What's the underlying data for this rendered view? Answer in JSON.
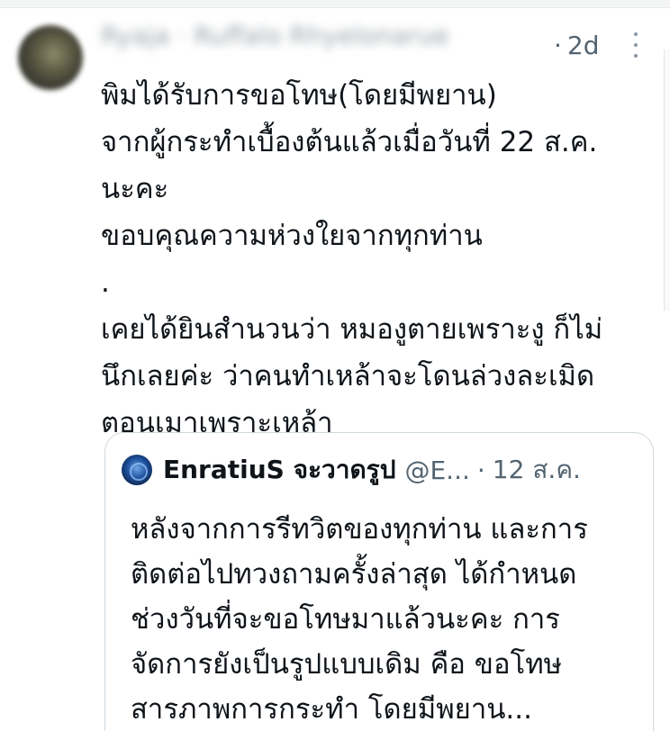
{
  "tweet": {
    "display_name": "Ryaja · Ruffalo Rhyelonarue",
    "separator": "·",
    "time": "2d",
    "more_icon": "more-vertical-icon",
    "lines": [
      "พิมได้รับการขอโทษ(โดยมีพยาน)",
      "จากผู้กระทำเบื้องต้นแล้วเมื่อวันที่ 22 ส.ค.",
      "นะคะ",
      "ขอบคุณความห่วงใยจากทุกท่าน",
      ".",
      "เคยได้ยินสำนวนว่า หมองูตายเพราะงู ก็ไม่",
      "นึกเลยค่ะ ว่าคนทำเหล้าจะโดนล่วงละเมิด",
      "ตอนเมาเพราะเหล้า"
    ]
  },
  "quote": {
    "name": "EnratiuS จะวาดรูป",
    "handle": "@E...",
    "separator": "·",
    "date": "12 ส.ค.",
    "avatar_icon": "blue-rose-avatar-icon",
    "lines": [
      "หลังจากการรีทวิตของทุกท่าน และการ",
      "ติดต่อไปทวงถามครั้งล่าสุด ได้กำหนด",
      "ช่วงวันที่จะขอโทษมาแล้วนะคะ การ",
      "จัดการยังเป็นรูปแบบเดิม คือ ขอโทษ",
      "สารภาพการกระทำ โดยมีพยาน..."
    ]
  },
  "colors": {
    "text": "#0f1419",
    "secondary": "#536471",
    "border": "#cfd9de"
  }
}
